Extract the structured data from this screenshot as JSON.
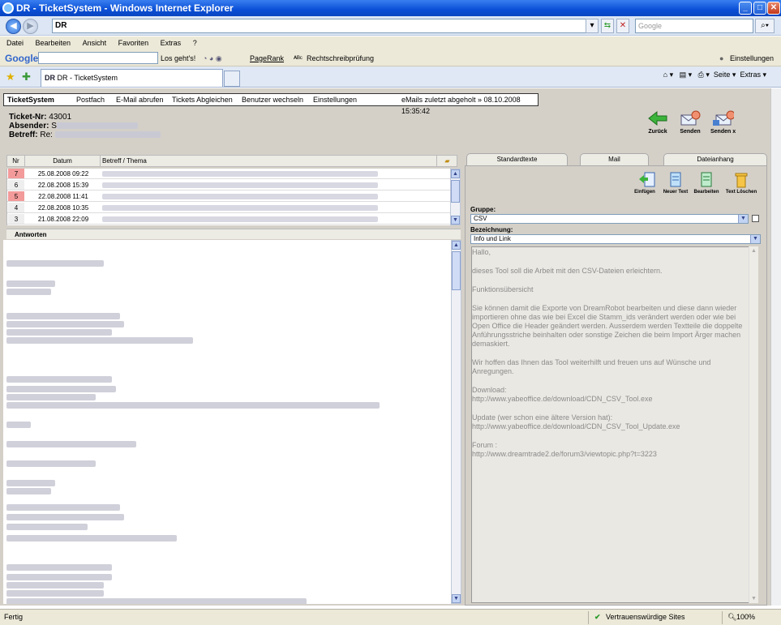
{
  "window": {
    "title": "DR - TicketSystem - Windows Internet Explorer",
    "buttons": {
      "minimize": "_",
      "maximize": "□",
      "close": "✕"
    }
  },
  "addressbar": {
    "url": "DR",
    "search_placeholder": "Google"
  },
  "menu": [
    "Datei",
    "Bearbeiten",
    "Ansicht",
    "Favoriten",
    "Extras",
    "?"
  ],
  "googlebar": {
    "logo": "Google",
    "go_label": "Los geht's!",
    "pagerank": "PageRank",
    "spellcheck": "Rechtschreibprüfung",
    "settings": "Einstellungen"
  },
  "tabs": {
    "active": "DR - TicketSystem",
    "favicon": "DR"
  },
  "ie_tools": {
    "page": "Seite",
    "extras": "Extras"
  },
  "app_nav": {
    "brand": "TicketSystem",
    "items": [
      "Postfach",
      "E-Mail abrufen",
      "Tickets Abgleichen",
      "Benutzer wechseln",
      "Einstellungen"
    ],
    "status": "eMails zuletzt abgeholt » 08.10.2008 15:35:42"
  },
  "ticket": {
    "nr_label": "Ticket-Nr:",
    "nr_value": "43001",
    "sender_label": "Absender:",
    "sender_value": "S",
    "subject_label": "Betreff:",
    "subject_value": "Re:"
  },
  "actions": {
    "back": "Zurück",
    "send": "Senden",
    "send_x": "Senden  x"
  },
  "table": {
    "columns": [
      "Nr",
      "Datum",
      "Betreff / Thema"
    ],
    "rows": [
      {
        "nr": "7",
        "date": "25.08.2008 09:22",
        "flag": "red"
      },
      {
        "nr": "6",
        "date": "22.08.2008 15:39",
        "flag": "none"
      },
      {
        "nr": "5",
        "date": "22.08.2008 11:41",
        "flag": "red"
      },
      {
        "nr": "4",
        "date": "22.08.2008 10:35",
        "flag": "none"
      },
      {
        "nr": "3",
        "date": "21.08.2008 22:09",
        "flag": "none"
      }
    ]
  },
  "answers_label": "Antworten",
  "right_tabs": [
    "Standardtexte",
    "Mail",
    "Dateianhang"
  ],
  "template_toolbar": {
    "insert": "Einfügen",
    "new_text": "Neuer Text",
    "edit": "Bearbeiten",
    "delete": "Text  Löschen"
  },
  "group": {
    "label": "Gruppe:",
    "value": "CSV"
  },
  "designation": {
    "label": "Bezeichnung:",
    "value": "Info und Link"
  },
  "template_text": [
    "Hallo,",
    "dieses Tool soll die Arbeit mit den CSV-Dateien erleichtern.",
    "Funktionsübersicht",
    "Sie können damit die Exporte von DreamRobot bearbeiten und diese dann wieder importieren ohne das wie bei Excel die Stamm_ids verändert werden oder wie bei Open Office die Header geändert werden. Ausserdem werden Textteile die doppelte Anführungsstriche beinhalten oder sonstige Zeichen die beim Import Ärger machen demaskiert.",
    "Wir hoffen das Ihnen das Tool weiterhilft und freuen uns auf Wünsche und Anregungen.",
    "Download:\nhttp://www.yabeoffice.de/download/CDN_CSV_Tool.exe",
    "Update (wer schon eine ältere Version hat):\nhttp://www.yabeoffice.de/download/CDN_CSV_Tool_Update.exe",
    "Forum :\nhttp://www.dreamtrade2.de/forum3/viewtopic.php?t=3223"
  ],
  "statusbar": {
    "left": "Fertig",
    "zone": "Vertrauenswürdige Sites",
    "zoom": "100%"
  },
  "colors": {
    "titlebar": "#0a4fd6",
    "unread_flag": "#f39a9a",
    "panel": "#d4d0c8"
  }
}
